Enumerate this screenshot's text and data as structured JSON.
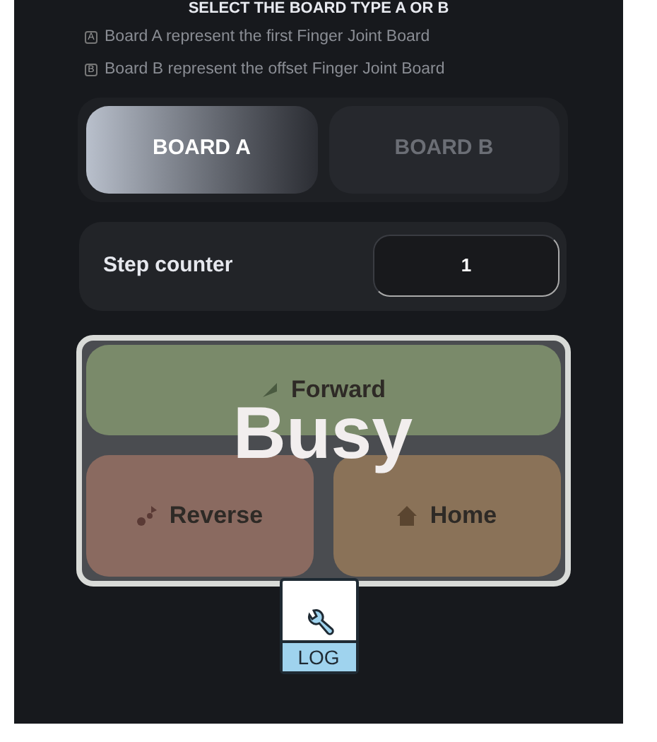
{
  "heading": "SELECT THE BOARD TYPE A OR B",
  "notes": [
    {
      "badge": "A",
      "text": "Board A represent the first Finger Joint Board"
    },
    {
      "badge": "B",
      "text": "Board B represent the offset Finger Joint Board"
    }
  ],
  "board_tabs": [
    {
      "label": "BOARD A",
      "selected": true
    },
    {
      "label": "BOARD B",
      "selected": false
    }
  ],
  "step_counter": {
    "label": "Step counter",
    "value": "1"
  },
  "controls": [
    {
      "kind": "forward",
      "label": "Forward",
      "color": "#7a8a6a"
    },
    {
      "kind": "reverse",
      "label": "Reverse",
      "color": "#8a6a60"
    },
    {
      "kind": "home",
      "label": "Home",
      "color": "#8a7258"
    }
  ],
  "overlay": {
    "text": "Busy"
  },
  "log_file": {
    "label": "LOG"
  }
}
